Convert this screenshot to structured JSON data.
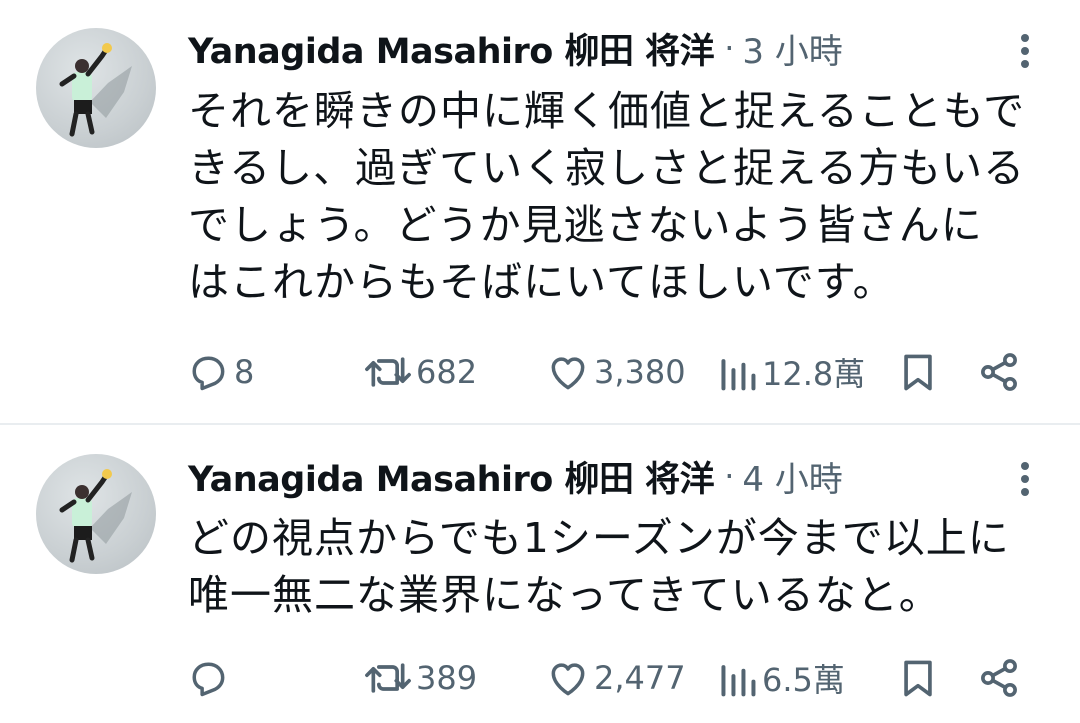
{
  "tweets": [
    {
      "author": "Yanagida Masahiro 柳田 将洋",
      "separator": "·",
      "time": "3 小時",
      "text_lines": [
        "それを瞬きの中に輝く価値と捉えることもで",
        "きるし、過ぎていく寂しさと捉える方もいる",
        "でしょう。どうか見逃さないよう皆さんに",
        "はこれからもそばにいてほしいです。"
      ],
      "replies": "8",
      "retweets": "682",
      "likes": "3,380",
      "views": "12.8萬"
    },
    {
      "author": "Yanagida Masahiro 柳田 将洋",
      "separator": "·",
      "time": "4 小時",
      "text_lines": [
        "どの視点からでも1シーズンが今まで以上に",
        "唯一無二な業界になってきているなと。"
      ],
      "replies": "",
      "retweets": "389",
      "likes": "2,477",
      "views": "6.5萬"
    }
  ],
  "icons": [
    "more-vertical-icon",
    "reply-icon",
    "retweet-icon",
    "like-icon",
    "views-icon",
    "bookmark-icon",
    "share-icon"
  ],
  "colors": {
    "text": "#0f1419",
    "muted": "#536471",
    "divider": "#e9edf0"
  }
}
